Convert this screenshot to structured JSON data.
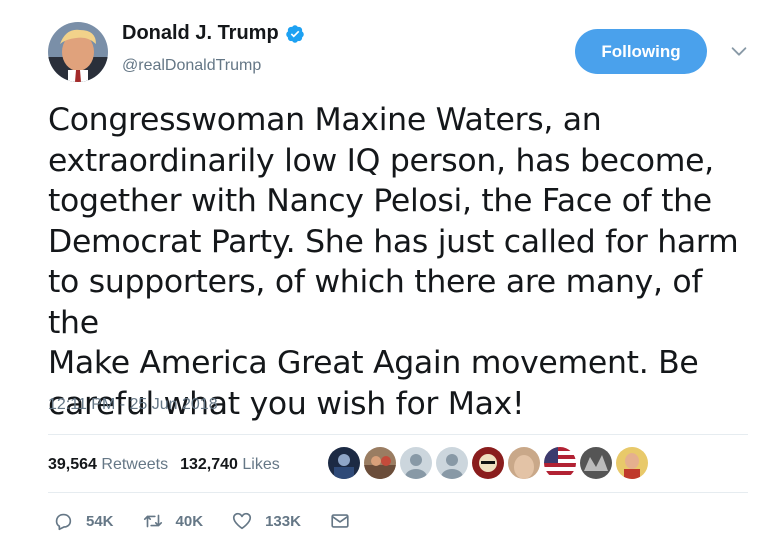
{
  "author": {
    "name": "Donald J. Trump",
    "handle": "@realDonaldTrump",
    "verified": true
  },
  "follow_button": {
    "label": "Following",
    "color": "#4aa1ec"
  },
  "tweet": {
    "text": "Congresswoman Maxine Waters, an\nextraordinarily low IQ person, has become,\ntogether with Nancy Pelosi, the Face of the\nDemocrat Party. She has just called for harm\nto supporters, of which there are many, of the\nMake America Great Again movement. Be\ncareful what you wish for Max!",
    "timestamp": "12:11 PM - 25 Jun 2018"
  },
  "stats": {
    "retweets_count": "39,564",
    "retweets_label": "Retweets",
    "likes_count": "132,740",
    "likes_label": "Likes"
  },
  "likers": [
    {
      "icon": "avatar-photo"
    },
    {
      "icon": "avatar-photo"
    },
    {
      "icon": "default-egg-avatar"
    },
    {
      "icon": "default-egg-avatar"
    },
    {
      "icon": "avatar-photo"
    },
    {
      "icon": "avatar-photo"
    },
    {
      "icon": "avatar-flag"
    },
    {
      "icon": "avatar-photo"
    },
    {
      "icon": "avatar-photo"
    }
  ],
  "actions": {
    "reply_count": "54K",
    "retweet_count": "40K",
    "like_count": "133K"
  },
  "colors": {
    "text": "#14171a",
    "secondary": "#657786",
    "accent": "#1da1f2",
    "divider": "#e6ecf0"
  }
}
